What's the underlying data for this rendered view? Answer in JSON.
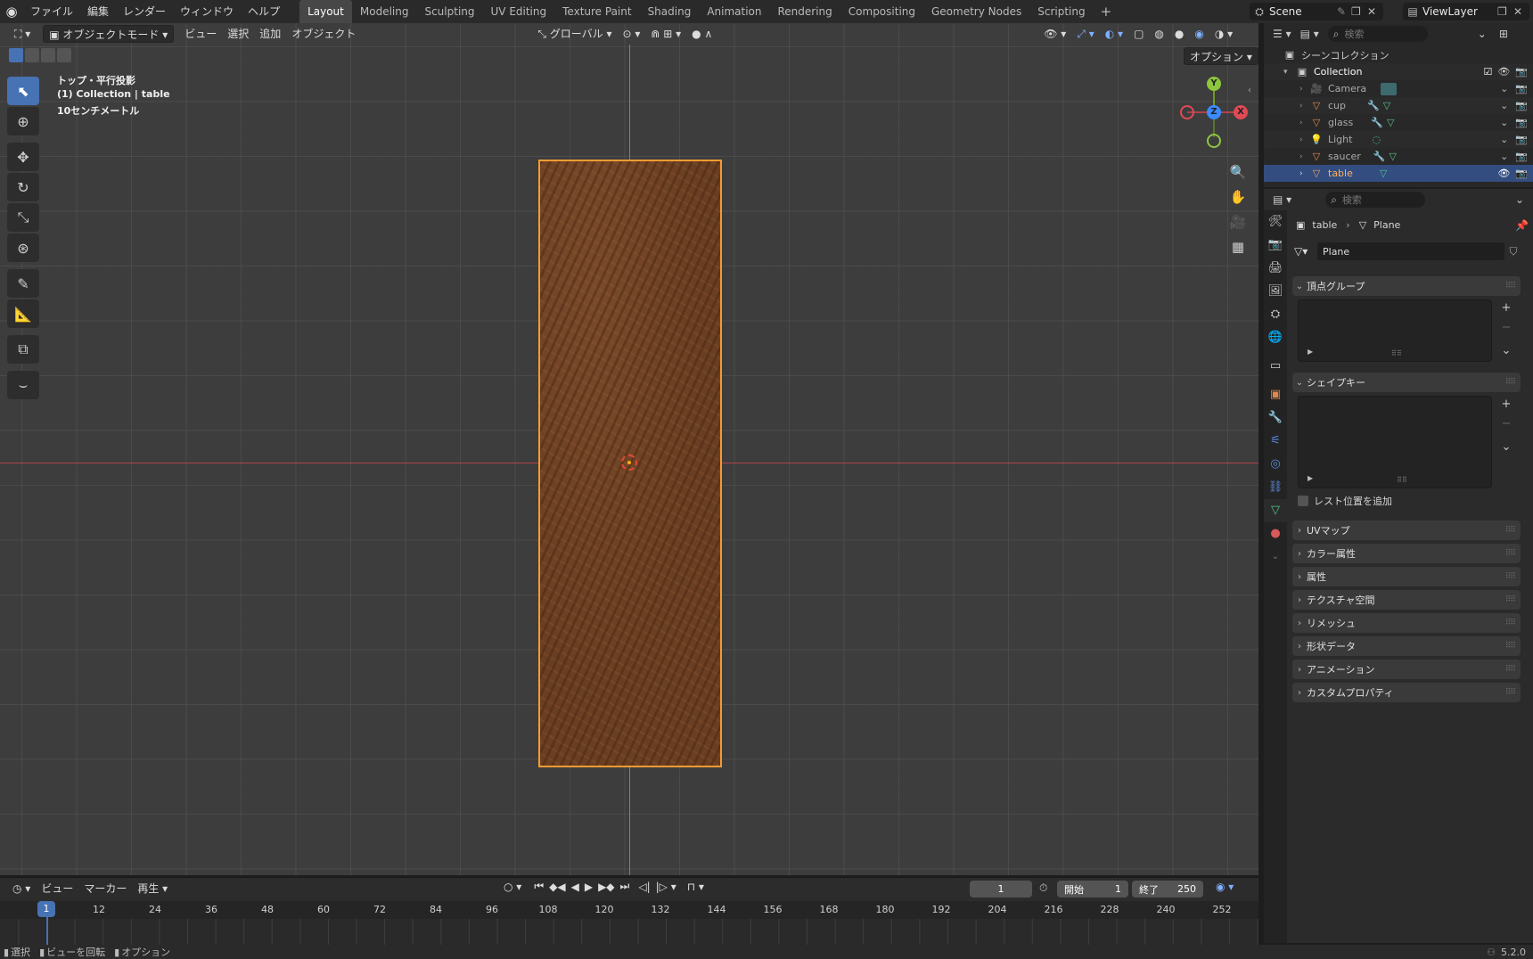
{
  "topbar": {
    "menus": [
      "ファイル",
      "編集",
      "レンダー",
      "ウィンドウ",
      "ヘルプ"
    ],
    "workspaces": [
      "Layout",
      "Modeling",
      "Sculpting",
      "UV Editing",
      "Texture Paint",
      "Shading",
      "Animation",
      "Rendering",
      "Compositing",
      "Geometry Nodes",
      "Scripting"
    ],
    "active_workspace": "Layout",
    "add_symbol": "+",
    "scene": "Scene",
    "view_layer": "ViewLayer"
  },
  "viewport": {
    "mode": "オブジェクトモード",
    "menus": [
      "ビュー",
      "選択",
      "追加",
      "オブジェクト"
    ],
    "orientation": "グローバル",
    "options_label": "オプション",
    "info_view": "トップ・平行投影",
    "info_collection": "(1) Collection | table",
    "info_scale": "10センチメートル",
    "gizmo": {
      "x": "X",
      "y": "Y",
      "z": "Z"
    }
  },
  "timeline": {
    "menus": [
      "ビュー",
      "マーカー",
      "再生"
    ],
    "current_frame": "1",
    "start_label": "開始",
    "start_value": "1",
    "end_label": "終了",
    "end_value": "250",
    "ticks": [
      "12",
      "24",
      "36",
      "48",
      "60",
      "72",
      "84",
      "96",
      "108",
      "120",
      "132",
      "144",
      "156",
      "168",
      "180",
      "192",
      "204",
      "216",
      "228",
      "240",
      "252"
    ],
    "cursor_label": "1"
  },
  "statusbar": {
    "items": [
      "選択",
      "ビューを回転",
      "オプション"
    ],
    "version": "5.2.0"
  },
  "outliner": {
    "search_placeholder": "検索",
    "scene_collection": "シーンコレクション",
    "collection": "Collection",
    "objects": [
      "Camera",
      "cup",
      "glass",
      "Light",
      "saucer",
      "table"
    ],
    "selected": "table"
  },
  "properties": {
    "search_placeholder": "検索",
    "breadcrumb_object": "table",
    "breadcrumb_data": "Plane",
    "mesh_name": "Plane",
    "panels_open": [
      "頂点グループ",
      "シェイプキー"
    ],
    "rest_position_label": "レスト位置を追加",
    "panels_closed": [
      "UVマップ",
      "カラー属性",
      "属性",
      "テクスチャ空間",
      "リメッシュ",
      "形状データ",
      "アニメーション",
      "カスタムプロパティ"
    ]
  },
  "colors": {
    "accent": "#4772b3",
    "selection": "#f39b32",
    "axis_x": "#b0424a",
    "axis_y": "#6e9a25"
  }
}
